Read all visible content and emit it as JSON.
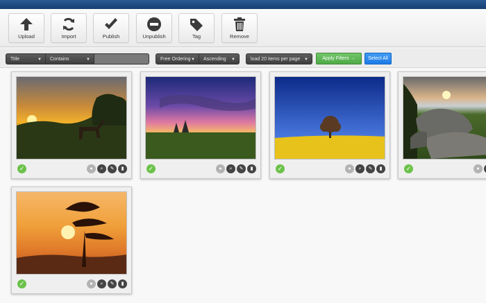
{
  "toolbar": {
    "upload": "Upload",
    "import": "Import",
    "publish": "Publish",
    "unpublish": "Unpublish",
    "tag": "Tag",
    "remove": "Remove"
  },
  "filters": {
    "field": "Title",
    "operator": "Contains",
    "search_value": "",
    "ordering": "Free Ordering",
    "direction": "Ascending",
    "per_page": "load 20 items per page",
    "apply": "Apply Filters →",
    "select_all": "Select All"
  },
  "items": [
    {
      "image": "sunset-deer-in-field",
      "published": true
    },
    {
      "image": "purple-sunset-field-trees",
      "published": true
    },
    {
      "image": "tree-in-yellow-rapeseed-field",
      "published": true
    },
    {
      "image": "rocks-at-sunset",
      "published": true
    },
    {
      "image": "pine-tree-silhouette-sunset",
      "published": true
    }
  ],
  "colors": {
    "header": "#1c4a82",
    "apply_button": "#5cb85c",
    "select_all_button": "#2a8cf0",
    "published_check": "#6cc24a"
  }
}
